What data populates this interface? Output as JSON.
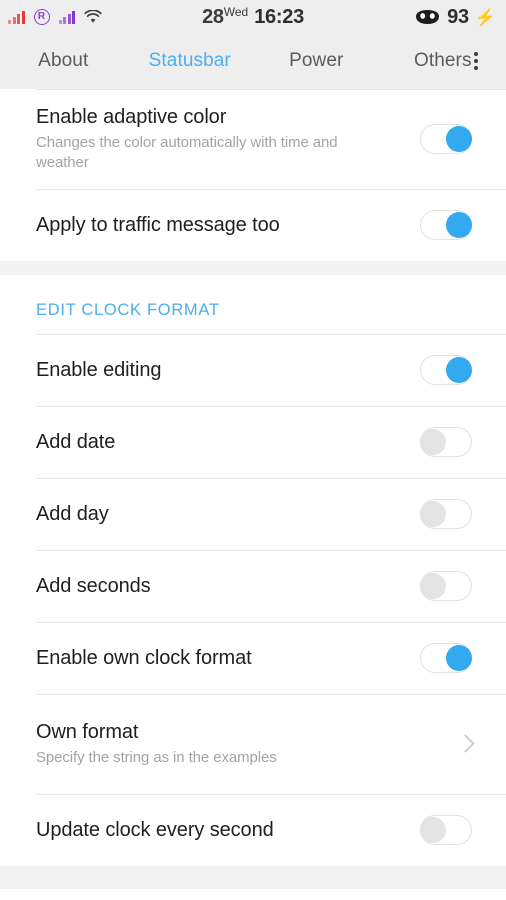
{
  "statusbar": {
    "date": "28",
    "day_of_week": "Wed",
    "time": "16:23",
    "battery_level": "93",
    "charging_glyph": "⚡",
    "roaming_glyph": "R",
    "icons": [
      "signal-bars-sim1-icon",
      "roaming-icon",
      "signal-bars-sim2-icon",
      "wifi-icon",
      "battery-icon",
      "charging-bolt-icon"
    ]
  },
  "tabs": [
    {
      "label": "About",
      "active": false
    },
    {
      "label": "Statusbar",
      "active": true
    },
    {
      "label": "Power",
      "active": false
    },
    {
      "label": "Others",
      "active": false
    }
  ],
  "sections": [
    {
      "header": null,
      "rows": [
        {
          "title": "Enable adaptive color",
          "subtitle": "Changes the color automatically with time and weather",
          "control": "toggle",
          "state": "on"
        },
        {
          "title": "Apply to traffic message too",
          "subtitle": null,
          "control": "toggle",
          "state": "on"
        }
      ]
    },
    {
      "header": "EDIT CLOCK FORMAT",
      "rows": [
        {
          "title": "Enable editing",
          "subtitle": null,
          "control": "toggle",
          "state": "on"
        },
        {
          "title": "Add date",
          "subtitle": null,
          "control": "toggle",
          "state": "off"
        },
        {
          "title": "Add day",
          "subtitle": null,
          "control": "toggle",
          "state": "off"
        },
        {
          "title": "Add seconds",
          "subtitle": null,
          "control": "toggle",
          "state": "off"
        },
        {
          "title": "Enable own clock format",
          "subtitle": null,
          "control": "toggle",
          "state": "on"
        },
        {
          "title": "Own format",
          "subtitle": "Specify the string as in the examples",
          "control": "chevron",
          "state": null
        },
        {
          "title": "Update clock every second",
          "subtitle": null,
          "control": "toggle",
          "state": "off"
        }
      ]
    }
  ],
  "colors": {
    "accent": "#4aaef0",
    "toggle_on": "#33a9ef",
    "toggle_off": "#e4e4e4",
    "title": "#1f1f1f",
    "subtitle": "#a3a3a3",
    "bar_background": "#eeeeee"
  }
}
